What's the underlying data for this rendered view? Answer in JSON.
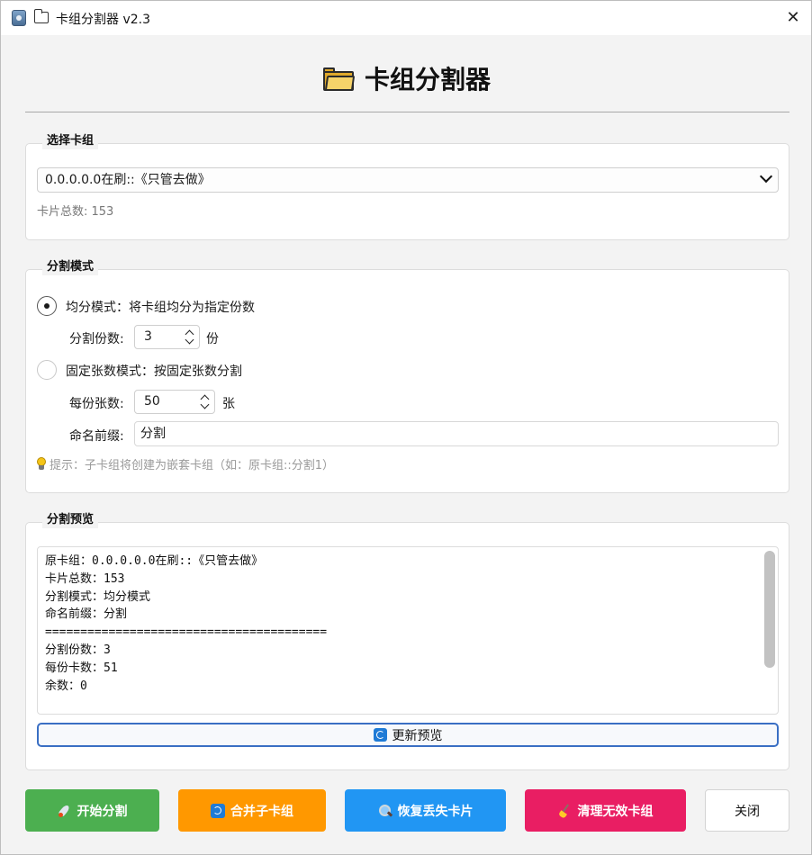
{
  "window": {
    "title": "卡组分割器 v2.3",
    "close_symbol": "✕"
  },
  "header": {
    "title": "卡组分割器"
  },
  "deck_select": {
    "group_title": "选择卡组",
    "selected_deck": "0.0.0.0.0在刷::《只管去做》",
    "card_count_text": "卡片总数: 153"
  },
  "split_mode": {
    "group_title": "分割模式",
    "even_option": {
      "label": "均分模式：将卡组均分为指定份数",
      "checked": true,
      "field_label": "分割份数:",
      "value": "3",
      "unit": "份"
    },
    "fixed_option": {
      "label": "固定张数模式：按固定张数分割",
      "checked": false,
      "field_label": "每份张数:",
      "value": "50",
      "unit": "张"
    },
    "prefix": {
      "label": "命名前缀:",
      "value": "分割"
    },
    "tip": "提示：子卡组将创建为嵌套卡组（如：原卡组::分割1）"
  },
  "preview": {
    "group_title": "分割预览",
    "lines": [
      "原卡组：0.0.0.0.0在刷::《只管去做》",
      "卡片总数：153",
      "分割模式：均分模式",
      "命名前缀：分割",
      "========================================",
      "分割份数：3",
      "每份卡数：51",
      "余数：0"
    ],
    "refresh_label": "更新预览"
  },
  "actions": {
    "start": {
      "label": "开始分割",
      "icon": "rocket-icon",
      "color": "#4caf50"
    },
    "merge": {
      "label": "合并子卡组",
      "icon": "sync-icon",
      "color": "#ff9800"
    },
    "recover": {
      "label": "恢复丢失卡片",
      "icon": "magnifier-icon",
      "color": "#2196f3"
    },
    "clean": {
      "label": "清理无效卡组",
      "icon": "broom-icon",
      "color": "#e91e63"
    },
    "close": {
      "label": "关闭"
    }
  }
}
